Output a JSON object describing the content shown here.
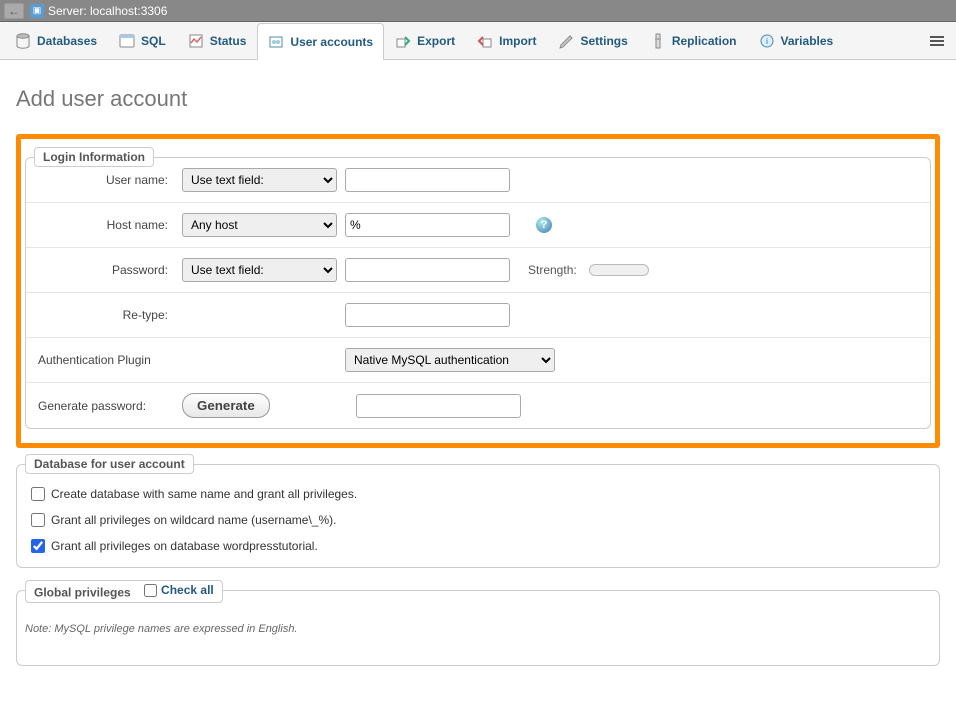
{
  "topbar": {
    "server_label": "Server: localhost:3306"
  },
  "nav": {
    "items": [
      {
        "label": "Databases",
        "icon": "db"
      },
      {
        "label": "SQL",
        "icon": "sql"
      },
      {
        "label": "Status",
        "icon": "status"
      },
      {
        "label": "User accounts",
        "icon": "users",
        "active": true
      },
      {
        "label": "Export",
        "icon": "export"
      },
      {
        "label": "Import",
        "icon": "import"
      },
      {
        "label": "Settings",
        "icon": "settings"
      },
      {
        "label": "Replication",
        "icon": "repl"
      },
      {
        "label": "Variables",
        "icon": "vars"
      }
    ]
  },
  "page": {
    "title": "Add user account"
  },
  "login_info": {
    "legend": "Login Information",
    "username_label": "User name:",
    "username_select": "Use text field:",
    "username_value": "",
    "hostname_label": "Host name:",
    "hostname_select": "Any host",
    "hostname_value": "%",
    "password_label": "Password:",
    "password_select": "Use text field:",
    "password_value": "",
    "strength_label": "Strength:",
    "retype_label": "Re-type:",
    "retype_value": "",
    "auth_label": "Authentication Plugin",
    "auth_select": "Native MySQL authentication",
    "gen_label": "Generate password:",
    "gen_button": "Generate",
    "gen_value": ""
  },
  "db_section": {
    "legend": "Database for user account",
    "opt1": "Create database with same name and grant all privileges.",
    "opt2": "Grant all privileges on wildcard name (username\\_%).",
    "opt3": "Grant all privileges on database wordpresstutorial."
  },
  "global_priv": {
    "legend": "Global privileges",
    "check_all": "Check all"
  },
  "note": "Note: MySQL privilege names are expressed in English."
}
